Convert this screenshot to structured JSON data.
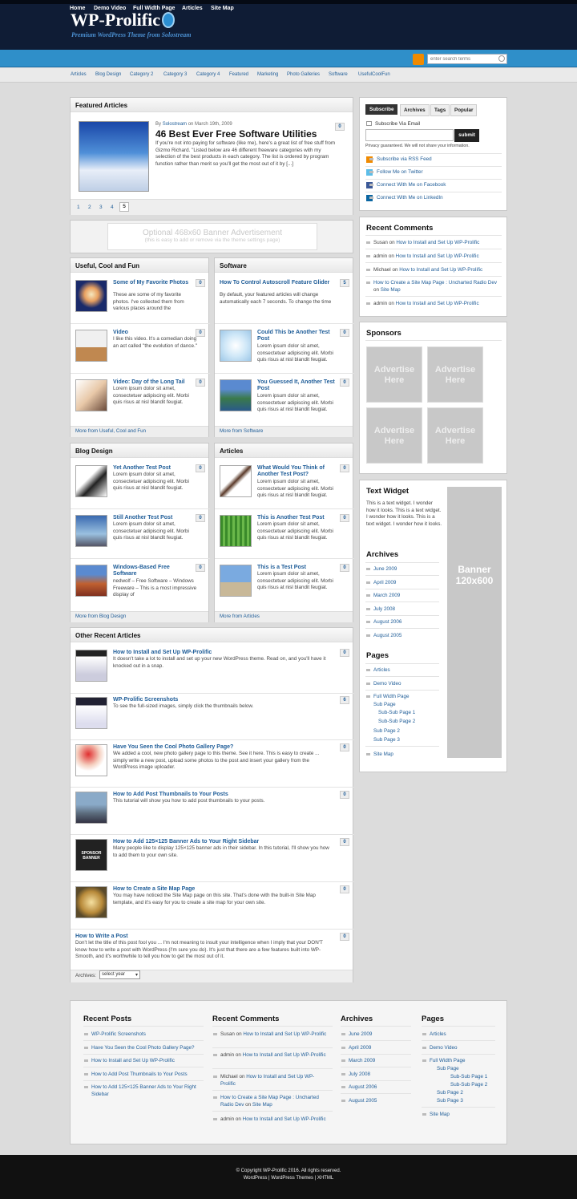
{
  "site": {
    "title": "WP-Prolific",
    "tagline": "Premium WordPress Theme from Solostream"
  },
  "nav": [
    "Home",
    "Demo Video",
    "Full Width Page",
    "Articles",
    "Site Map"
  ],
  "search": {
    "placeholder": "enter search terms"
  },
  "subnav": [
    "Articles",
    "Blog Design",
    "Category 2",
    "Category 3",
    "Category 4",
    "Featured",
    "Marketing",
    "Photo Galleries",
    "Software",
    "UsefulCoolFun"
  ],
  "featured": {
    "heading": "Featured Articles",
    "byline_prefix": "By",
    "author": "Solostream",
    "date": "on March 19th, 2009",
    "title": "46 Best Ever Free Software Utilities",
    "excerpt": "If you're not into paying for software (like me), here's a great list of free stuff from Gizmo Richard. \"Listed below are 46 different freeware categories with my selection of the best products in each category. The list is ordered by program function rather than merit so you'll get the most out of it by [...]",
    "comments": "0",
    "pages": [
      "1",
      "2",
      "3",
      "4",
      "5"
    ]
  },
  "banner": {
    "line1": "Optional 468x60 Banner Advertisement",
    "line2": "(this is easy to add or remove via the theme settings page)"
  },
  "cat_boxes": [
    {
      "heading": "Useful, Cool and Fun",
      "more": "More from Useful, Cool and Fun",
      "posts": [
        {
          "title": "Some of My Favorite Photos",
          "text": "These are some of my favorite photos. I've collected them from various places around the",
          "count": "0"
        },
        {
          "title": "Video",
          "text": "I like this video. It's a comedian doing an act called \"the evolution of dance.\"",
          "count": "0"
        },
        {
          "title": "Video: Day of the Long Tail",
          "text": "Lorem ipsum dolor sit amet, consectetuer adipiscing elit. Morbi quis risus at nisl blandit feugiat.",
          "count": "0"
        }
      ]
    },
    {
      "heading": "Software",
      "more": "More from Software",
      "posts": [
        {
          "title": "How To Control Autoscroll Feature Glider",
          "text": "By default, your featured articles will change automatically each 7 seconds. To change the time",
          "count": "5"
        },
        {
          "title": "Could This be Another Test Post",
          "text": "Lorem ipsum dolor sit amet, consectetuer adipiscing elit. Morbi quis risus at nisl blandit feugiat.",
          "count": "0"
        },
        {
          "title": "You Guessed It, Another Test Post",
          "text": "Lorem ipsum dolor sit amet, consectetuer adipiscing elit. Morbi quis risus at nisl blandit feugiat.",
          "count": "0"
        }
      ]
    },
    {
      "heading": "Blog Design",
      "more": "More from Blog Design",
      "posts": [
        {
          "title": "Yet Another Test Post",
          "text": "Lorem ipsum dolor sit amet, consectetuer adipiscing elit. Morbi quis risus at nisl blandit feugiat.",
          "count": "0"
        },
        {
          "title": "Still Another Test Post",
          "text": "Lorem ipsum dolor sit amet, consectetuer adipiscing elit. Morbi quis risus at nisl blandit feugiat.",
          "count": "0"
        },
        {
          "title": "Windows-Based Free Software",
          "text": "nedwolf – Free Software – Windows Freeware – This is a most impressive display of",
          "count": "0"
        }
      ]
    },
    {
      "heading": "Articles",
      "more": "More from Articles",
      "posts": [
        {
          "title": "What Would You Think of Another Test Post?",
          "text": "Lorem ipsum dolor sit amet, consectetuer adipiscing elit. Morbi quis risus at nisl blandit feugiat.",
          "count": "0"
        },
        {
          "title": "This is Another Test Post",
          "text": "Lorem ipsum dolor sit amet, consectetuer adipiscing elit. Morbi quis risus at nisl blandit feugiat.",
          "count": "0"
        },
        {
          "title": "This is a Test Post",
          "text": "Lorem ipsum dolor sit amet, consectetuer adipiscing elit. Morbi quis risus at nisl blandit feugiat.",
          "count": "0"
        }
      ]
    }
  ],
  "other": {
    "heading": "Other Recent Articles",
    "archives_label": "Archives:",
    "archives_select": "select year",
    "posts": [
      {
        "title": "How to Install and Set Up WP-Prolific",
        "text": "It doesn't take a lot to install and set up your new WordPress theme. Read on, and you'll have it knocked out in a snap.",
        "count": "0"
      },
      {
        "title": "WP-Prolific Screenshots",
        "text": "To see the full-sized images, simply click the thumbnails below.",
        "count": "6"
      },
      {
        "title": "Have You Seen the Cool Photo Gallery Page?",
        "text": "We added a cool, new photo gallery page to this theme. See it here. This is easy to create ... simply write a new post, upload some photos to the post and insert your gallery from the WordPress image uploader.",
        "count": "0"
      },
      {
        "title": "How to Add Post Thumbnails to Your Posts",
        "text": "This tutorial will show you how to add post thumbnails to your posts.",
        "count": "0"
      },
      {
        "title": "How to Add 125×125 Banner Ads to Your Right Sidebar",
        "text": "Many people like to display 125×125 banner ads in their sidebar. In this tutorial, I'll show you how to add them to your own site.",
        "count": "0",
        "thumb_text": "SPONSOR BANNER"
      },
      {
        "title": "How to Create a Site Map Page",
        "text": "You may have noticed the Site Map page on this site. That's done with the built-in Site Map template, and it's easy for you to create a site map for your own site.",
        "count": "0"
      },
      {
        "title": "How to Write a Post",
        "text": "Don't let the title of this post fool you ... I'm not meaning to insult your intelligence when I imply that your DON'T know how to write a post with WordPress (I'm sure you do). It's just that there are a few features built into WP-Smooth, and it's worthwhile to tell you how to get the most out of it.",
        "count": "0"
      }
    ]
  },
  "sidebar": {
    "tabs": [
      "Subscribe",
      "Archives",
      "Tags",
      "Popular"
    ],
    "subscribe_label": "Subscribe Via Email",
    "submit": "submit",
    "privacy": "Privacy guaranteed. We will not share your information.",
    "links": [
      "Subscribe via RSS Feed",
      "Follow Me on Twitter",
      "Connect With Me on Facebook",
      "Connect With Me on LinkedIn"
    ],
    "recent_heading": "Recent Comments",
    "recent": [
      {
        "who": "Susan",
        "on": "on",
        "post": "How to Install and Set Up WP-Prolific"
      },
      {
        "who": "admin",
        "on": "on",
        "post": "How to Install and Set Up WP-Prolific"
      },
      {
        "who": "Michael",
        "on": "on",
        "post": "How to Install and Set Up WP-Prolific"
      },
      {
        "who": "How to Create a Site Map Page : Uncharted Radio Dev",
        "on": "on",
        "post": "Site Map"
      },
      {
        "who": "admin",
        "on": "on",
        "post": "How to Install and Set Up WP-Prolific"
      }
    ],
    "sponsors_heading": "Sponsors",
    "ad_text": "Advertise Here",
    "text_widget_heading": "Text Widget",
    "text_widget": "This is a text widget. I wonder how it looks. This is a text widget. I wonder how it looks. This is a text widget. I wonder how it looks.",
    "archives_heading": "Archives",
    "archives": [
      "June 2009",
      "April 2009",
      "March 2009",
      "July 2008",
      "August 2006",
      "August 2005"
    ],
    "pages_heading": "Pages",
    "pages": [
      "Articles",
      "Demo Video",
      "Full Width Page",
      "Sub Page",
      "Sub-Sub Page 1",
      "Sub-Sub Page 2",
      "Sub Page 2",
      "Sub Page 3",
      "Site Map"
    ],
    "banner": "Banner 120x600"
  },
  "footer": {
    "recent_posts_heading": "Recent Posts",
    "recent_posts": [
      "WP-Prolific Screenshots",
      "Have You Seen the Cool Photo Gallery Page?",
      "How to Install and Set Up WP-Prolific",
      "How to Add Post Thumbnails to Your Posts",
      "How to Add 125×125 Banner Ads to Your Right Sidebar"
    ],
    "recent_comments_heading": "Recent Comments",
    "archives_heading": "Archives",
    "pages_heading": "Pages",
    "copyright": "© Copyright WP-Prolific 2016. All rights reserved.",
    "credits": "WordPress | WordPress Themes | XHTML"
  }
}
